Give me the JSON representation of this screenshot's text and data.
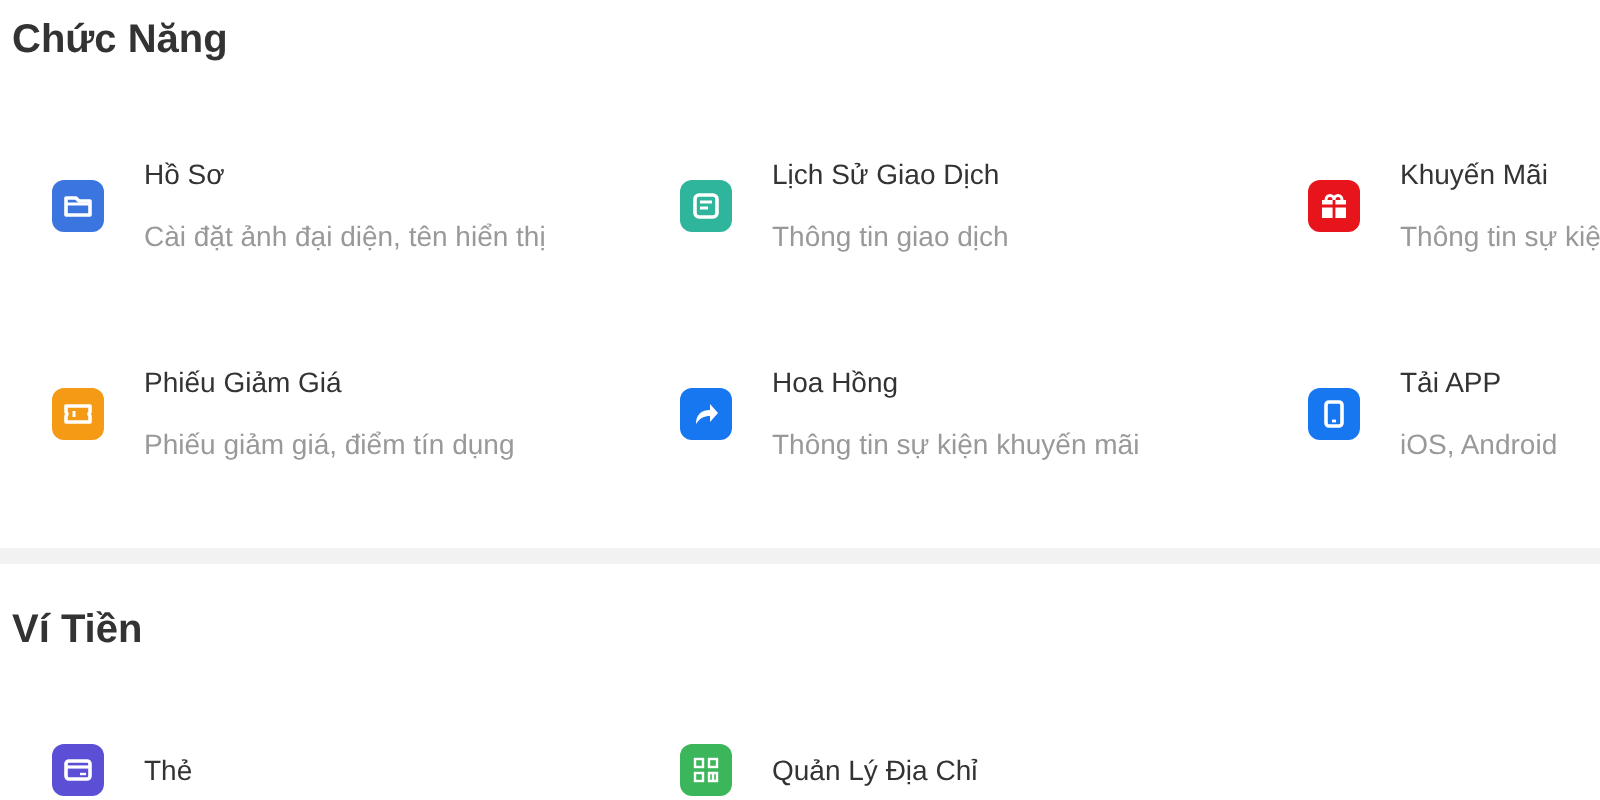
{
  "sections": [
    {
      "title": "Chức Năng",
      "items": [
        {
          "kind": "folder",
          "title": "Hồ Sơ",
          "subtitle": "Cài đặt ảnh đại diện, tên hiển thị"
        },
        {
          "kind": "document",
          "title": "Lịch Sử Giao Dịch",
          "subtitle": "Thông tin giao dịch"
        },
        {
          "kind": "gift",
          "title": "Khuyến Mãi",
          "subtitle": "Thông tin sự kiệ"
        },
        {
          "kind": "ticket",
          "title": "Phiếu Giảm Giá",
          "subtitle": "Phiếu giảm giá, điểm tín dụng"
        },
        {
          "kind": "share",
          "title": "Hoa Hồng",
          "subtitle": "Thông tin sự kiện khuyến mãi"
        },
        {
          "kind": "phone",
          "title": "Tải APP",
          "subtitle": "iOS, Android"
        }
      ]
    },
    {
      "title": "Ví Tiền",
      "items": [
        {
          "kind": "card",
          "title": "Thẻ"
        },
        {
          "kind": "qr",
          "title": "Quản Lý Địa Chỉ"
        }
      ]
    }
  ]
}
